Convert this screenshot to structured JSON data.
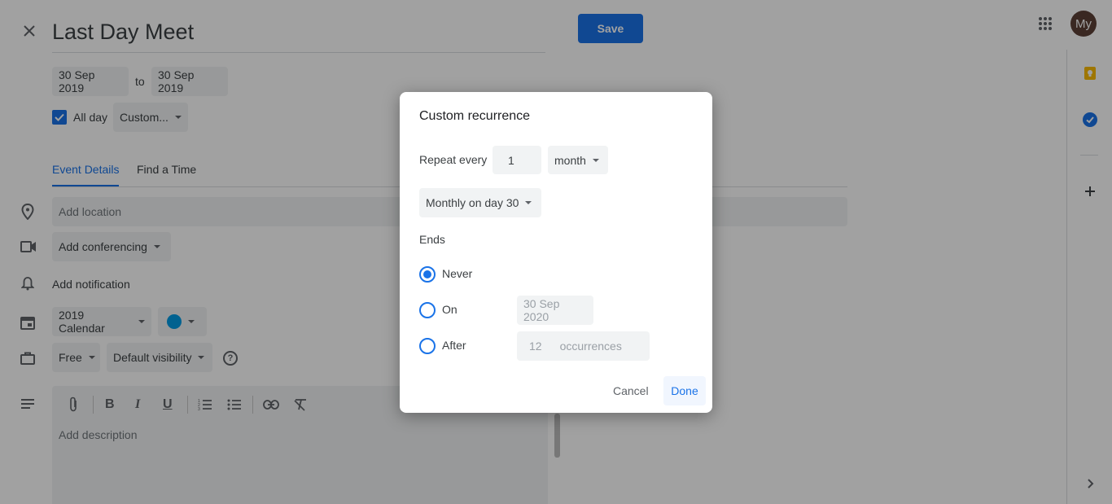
{
  "header": {
    "title": "Last Day Meet",
    "save_label": "Save",
    "avatar_text": "My"
  },
  "dates": {
    "start": "30 Sep 2019",
    "to_label": "to",
    "end": "30 Sep 2019",
    "all_day_label": "All day",
    "all_day_checked": true,
    "recurrence_value": "Custom..."
  },
  "tabs": [
    {
      "label": "Event Details",
      "active": true
    },
    {
      "label": "Find a Time",
      "active": false
    }
  ],
  "details": {
    "location_placeholder": "Add location",
    "conferencing_label": "Add conferencing",
    "notification_label": "Add notification",
    "calendar_value": "2019 Calendar",
    "calendar_color": "#039be5",
    "availability_value": "Free",
    "visibility_value": "Default visibility",
    "help_icon_text": "?",
    "description_placeholder": "Add description"
  },
  "editor_toolbar": [
    "attachment-icon",
    "bold-icon",
    "italic-icon",
    "underline-icon",
    "numbered-list-icon",
    "bulleted-list-icon",
    "link-icon",
    "clear-formatting-icon"
  ],
  "side_panel": [
    "keep-icon",
    "tasks-icon",
    "add-icon",
    "chevron-right-icon"
  ],
  "dialog": {
    "title": "Custom recurrence",
    "repeat_every_label": "Repeat every",
    "repeat_count": "1",
    "repeat_unit": "month",
    "monthly_option": "Monthly on day 30",
    "ends_label": "Ends",
    "options": [
      {
        "label": "Never",
        "selected": true
      },
      {
        "label": "On",
        "selected": false,
        "value": "30 Sep 2020"
      },
      {
        "label": "After",
        "selected": false,
        "value": "12",
        "suffix": "occurrences"
      }
    ],
    "cancel_label": "Cancel",
    "done_label": "Done"
  },
  "colors": {
    "accent": "#1a73e8",
    "save_bg": "#1a73e8",
    "avatar_bg": "#5d4037"
  }
}
